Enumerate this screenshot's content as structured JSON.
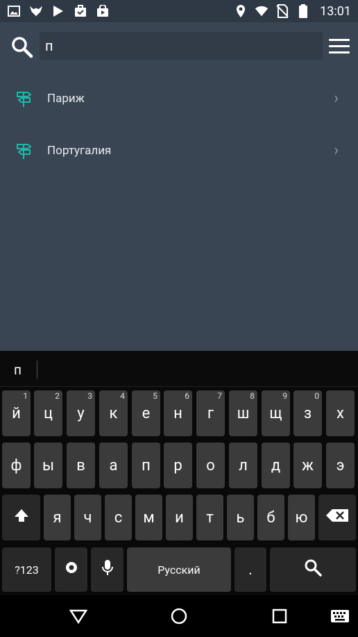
{
  "status_bar": {
    "time": "13:01",
    "left_icons": [
      "image-icon",
      "fox-icon",
      "play-store-icon",
      "briefcase-check-icon",
      "shopping-bag-icon"
    ],
    "right_icons": [
      "location-icon",
      "wifi-icon",
      "no-sim-icon",
      "battery-icon"
    ]
  },
  "header": {
    "search_value": "п",
    "menu_icon": "hamburger-menu-icon"
  },
  "results": [
    {
      "label": "Париж"
    },
    {
      "label": "Португалия"
    }
  ],
  "keyboard": {
    "suggestion": "п",
    "row1": [
      {
        "ch": "й",
        "hint": "1"
      },
      {
        "ch": "ц",
        "hint": "2"
      },
      {
        "ch": "у",
        "hint": "3"
      },
      {
        "ch": "к",
        "hint": "4"
      },
      {
        "ch": "е",
        "hint": "5"
      },
      {
        "ch": "н",
        "hint": "6"
      },
      {
        "ch": "г",
        "hint": "7"
      },
      {
        "ch": "ш",
        "hint": "8"
      },
      {
        "ch": "щ",
        "hint": "9"
      },
      {
        "ch": "з",
        "hint": "0"
      },
      {
        "ch": "х",
        "hint": ""
      }
    ],
    "row2": [
      "ф",
      "ы",
      "в",
      "а",
      "п",
      "р",
      "о",
      "л",
      "д",
      "ж",
      "э"
    ],
    "row3": [
      "я",
      "ч",
      "с",
      "м",
      "и",
      "т",
      "ь",
      "б",
      "ю"
    ],
    "sym_label": "?123",
    "lang_label": "Русский",
    "period_label": "."
  },
  "colors": {
    "app_background": "#3a4553",
    "search_field": "#323c48",
    "pin_accent": "#1fb8a8",
    "key": "#3b3b3b"
  }
}
